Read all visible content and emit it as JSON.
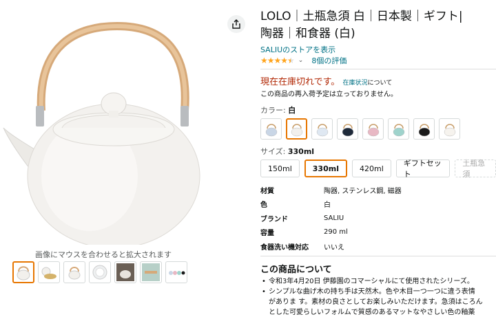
{
  "product": {
    "title_line1": "LOLO｜土瓶急須 白｜日本製｜ギフト|",
    "title_line2": "陶器｜和食器 (白)",
    "store_link": "SALIUのストアを表示",
    "rating_value": 4.5,
    "rating_count": "8個の評価"
  },
  "availability": {
    "status": "現在在庫切れです。",
    "stock_link": "在庫状況",
    "stock_suffix": "について",
    "restock_note": "この商品の再入荷予定は立っておりません。"
  },
  "color": {
    "label": "カラー: ",
    "selected": "白",
    "swatches": [
      {
        "name": "light-blue",
        "color": "#c9d6e6",
        "selected": false
      },
      {
        "name": "white",
        "color": "#f2f0ec",
        "selected": true
      },
      {
        "name": "pale-blue",
        "color": "#dfe8f2",
        "selected": false
      },
      {
        "name": "navy",
        "color": "#1f2a3a",
        "selected": false
      },
      {
        "name": "pink",
        "color": "#e8b8c4",
        "selected": false
      },
      {
        "name": "mint",
        "color": "#9fd3cc",
        "selected": false
      },
      {
        "name": "black",
        "color": "#1b1b1b",
        "selected": false
      },
      {
        "name": "cream",
        "color": "#f6f3ee",
        "selected": false
      }
    ]
  },
  "size": {
    "label": "サイズ: ",
    "selected": "330ml",
    "options": [
      "150ml",
      "330ml",
      "420ml",
      "ギフトセット",
      "土瓶急須"
    ]
  },
  "specs": [
    {
      "key": "材質",
      "value": "陶器, ステンレス鋼, 磁器"
    },
    {
      "key": "色",
      "value": "白"
    },
    {
      "key": "ブランド",
      "value": "SALIU"
    },
    {
      "key": "容量",
      "value": "290 ml"
    },
    {
      "key": "食器洗い機対応",
      "value": "いいえ"
    }
  ],
  "about": {
    "title": "この商品について",
    "lines": [
      "令和3年4月20日 伊藤園のコマーシャルにて使用されたシリーズ。",
      "シンプルな曲げ木の持ち手は天然木。色や木目一つ一つに違う表情",
      "がありま す。素材の良さとしてお楽しみいただけます。急須はころん",
      "とした可愛らしいフォルムで質感のあるマットなやさしい色の釉薬"
    ]
  },
  "gallery": {
    "hover_hint": "画像にマウスを合わせると拡大されます",
    "thumbnails": [
      "teapot-front",
      "gold-set",
      "teapot-side",
      "plate",
      "teapot-dark",
      "trivet",
      "color-lineup"
    ]
  },
  "colors": {
    "accent": "#e77600",
    "link": "#007185",
    "out_of_stock": "#b12704",
    "star": "#ffa41c"
  }
}
